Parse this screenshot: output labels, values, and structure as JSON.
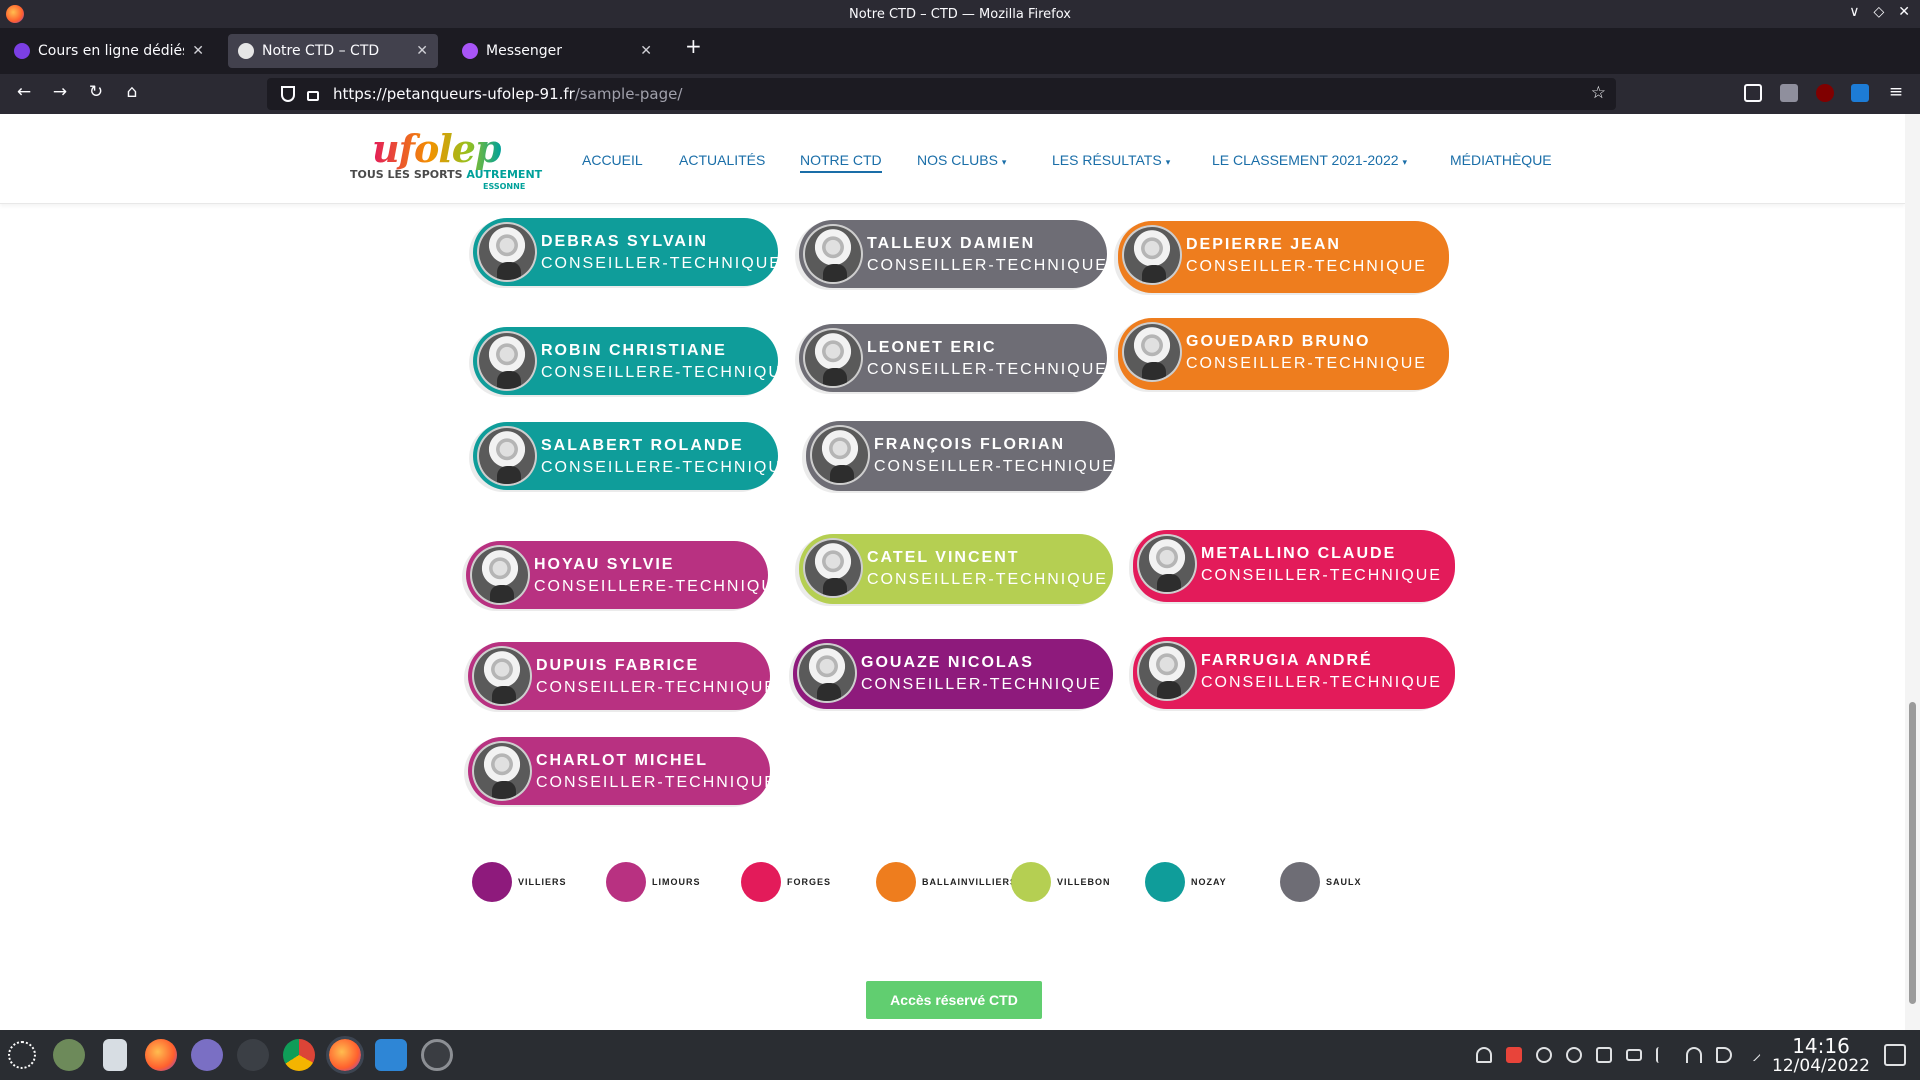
{
  "window": {
    "title": "Notre CTD – CTD — Mozilla Firefox",
    "controls": [
      "∨",
      "◇",
      "✕"
    ]
  },
  "tabs": [
    {
      "label": "Cours en ligne dédiés au",
      "favicon_color": "#7b3fe4",
      "active": false
    },
    {
      "label": "Notre CTD – CTD",
      "favicon_color": "#e6e6e6",
      "active": true
    },
    {
      "label": "Messenger",
      "favicon_color": "#a855f7",
      "active": false
    }
  ],
  "toolbar": {
    "back": "←",
    "forward": "→",
    "reload": "↻",
    "home": "⌂",
    "url_host": "https://petanqueurs-ufolep-91.fr",
    "url_path": "/sample-page/",
    "bookmark_star": "☆",
    "new_tab": "+",
    "menu": "≡",
    "close_tab": "✕"
  },
  "site": {
    "logo_word": "ufolep",
    "logo_tagline_a": "TOUS LES SPORTS ",
    "logo_tagline_b": "AUTREMENT",
    "logo_region": "ESSONNE",
    "menu": [
      {
        "label": "ACCUEIL",
        "has_dropdown": false,
        "current": false
      },
      {
        "label": "ACTUALITÉS",
        "has_dropdown": false,
        "current": false
      },
      {
        "label": "NOTRE CTD",
        "has_dropdown": false,
        "current": true
      },
      {
        "label": "NOS CLUBS",
        "has_dropdown": true,
        "current": false
      },
      {
        "label": "LES RÉSULTATS",
        "has_dropdown": true,
        "current": false
      },
      {
        "label": "LE CLASSEMENT 2021-2022",
        "has_dropdown": true,
        "current": false
      },
      {
        "label": "MÉDIATHÈQUE",
        "has_dropdown": false,
        "current": false
      }
    ],
    "menu_chevron": "▾"
  },
  "colors": {
    "villiers": "#8e1a7c",
    "limours": "#b83181",
    "forges": "#e31b5a",
    "ballainvilliers": "#ee7d1e",
    "villebon": "#b5cf52",
    "nozay": "#0f9d9a",
    "saulx": "#6e6d75"
  },
  "members": [
    {
      "name": "DEBRAS SYLVAIN",
      "role": "CONSEILLER-TECHNIQUE",
      "club": "nozay"
    },
    {
      "name": "TALLEUX DAMIEN",
      "role": "CONSEILLER-TECHNIQUE",
      "club": "saulx"
    },
    {
      "name": "DEPIERRE JEAN",
      "role": "CONSEILLER-TECHNIQUE",
      "club": "ballainvilliers"
    },
    {
      "name": "ROBIN CHRISTIANE",
      "role": "CONSEILLERE-TECHNIQUE",
      "club": "nozay"
    },
    {
      "name": "LEONET ERIC",
      "role": "CONSEILLER-TECHNIQUE",
      "club": "saulx"
    },
    {
      "name": "GOUEDARD BRUNO",
      "role": "CONSEILLER-TECHNIQUE",
      "club": "ballainvilliers"
    },
    {
      "name": "SALABERT ROLANDE",
      "role": "CONSEILLERE-TECHNIQUE",
      "club": "nozay"
    },
    {
      "name": "FRANÇOIS FLORIAN",
      "role": "CONSEILLER-TECHNIQUE",
      "club": "saulx"
    },
    {
      "name": "HOYAU SYLVIE",
      "role": "CONSEILLERE-TECHNIQUE",
      "club": "limours"
    },
    {
      "name": "CATEL VINCENT",
      "role": "CONSEILLER-TECHNIQUE",
      "club": "villebon"
    },
    {
      "name": "METALLINO CLAUDE",
      "role": "CONSEILLER-TECHNIQUE",
      "club": "forges"
    },
    {
      "name": "DUPUIS FABRICE",
      "role": "CONSEILLER-TECHNIQUE",
      "club": "limours"
    },
    {
      "name": "GOUAZE NICOLAS",
      "role": "CONSEILLER-TECHNIQUE",
      "club": "villiers"
    },
    {
      "name": "FARRUGIA ANDRÉ",
      "role": "CONSEILLER-TECHNIQUE",
      "club": "forges"
    },
    {
      "name": "CHARLOT MICHEL",
      "role": "CONSEILLER-TECHNIQUE",
      "club": "limours"
    }
  ],
  "legend": [
    {
      "label": "VILLIERS",
      "color": "#8e1a7c"
    },
    {
      "label": "LIMOURS",
      "color": "#b83181"
    },
    {
      "label": "FORGES",
      "color": "#e31b5a"
    },
    {
      "label": "BALLAINVILLIERS",
      "color": "#ee7d1e"
    },
    {
      "label": "VILLEBON",
      "color": "#b5cf52"
    },
    {
      "label": "NOZAY",
      "color": "#0f9d9a"
    },
    {
      "label": "SAULX",
      "color": "#6e6d75"
    }
  ],
  "cta": {
    "label": "Accès réservé CTD"
  },
  "taskbar": {
    "time": "14:16",
    "date": "12/04/2022",
    "apps": [
      "app-launcher-icon",
      "settings-icon",
      "files-icon",
      "firefox-icon",
      "folder-icon",
      "terminal-icon",
      "chrome-icon",
      "firefox-icon",
      "vscode-icon",
      "obs-icon"
    ]
  }
}
